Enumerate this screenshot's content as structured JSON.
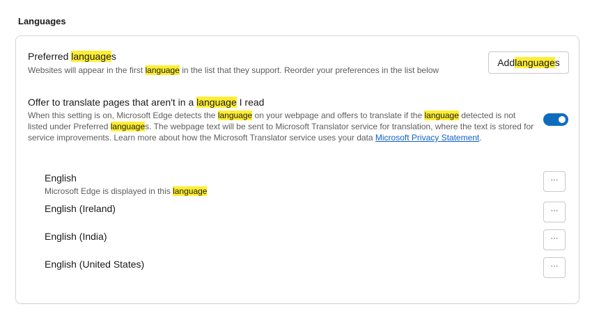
{
  "section": {
    "title": "Languages"
  },
  "preferred": {
    "title_pre": "Preferred ",
    "title_hl": "language",
    "title_post": "s",
    "desc_pre": "Websites will appear in the first ",
    "desc_hl": "language",
    "desc_post": " in the list that they support. Reorder your preferences in the list below",
    "add_button_hl": "language",
    "add_button_pre": "Add ",
    "add_button_post": "s"
  },
  "translate": {
    "title_pre": "Offer to translate pages that aren't in a ",
    "title_hl": "language",
    "title_post": " I read",
    "desc_1": "When this setting is on, Microsoft Edge detects the ",
    "desc_hl_1": "language",
    "desc_2": " on your webpage and offers to translate if the ",
    "desc_hl_2": "language",
    "desc_3": " detected is not listed under Preferred ",
    "desc_hl_3": "language",
    "desc_4": "s. The webpage text will be sent to Microsoft Translator service for translation, where the text is stored for service improvements. Learn more about how the Microsoft Translator service uses your data ",
    "link": "Microsoft Privacy Statement",
    "desc_5": ".",
    "toggle_on": true,
    "toggle_color": "#0f6cbd"
  },
  "languages": [
    {
      "name": "English",
      "sub_pre": "Microsoft Edge is displayed in this ",
      "sub_hl": "language",
      "more": "···"
    },
    {
      "name": "English (Ireland)",
      "more": "···"
    },
    {
      "name": "English (India)",
      "more": "···"
    },
    {
      "name": "English (United States)",
      "more": "···"
    }
  ],
  "colors": {
    "highlight": "#ffee33",
    "link": "#0f5fc7",
    "accent": "#0f6cbd"
  }
}
